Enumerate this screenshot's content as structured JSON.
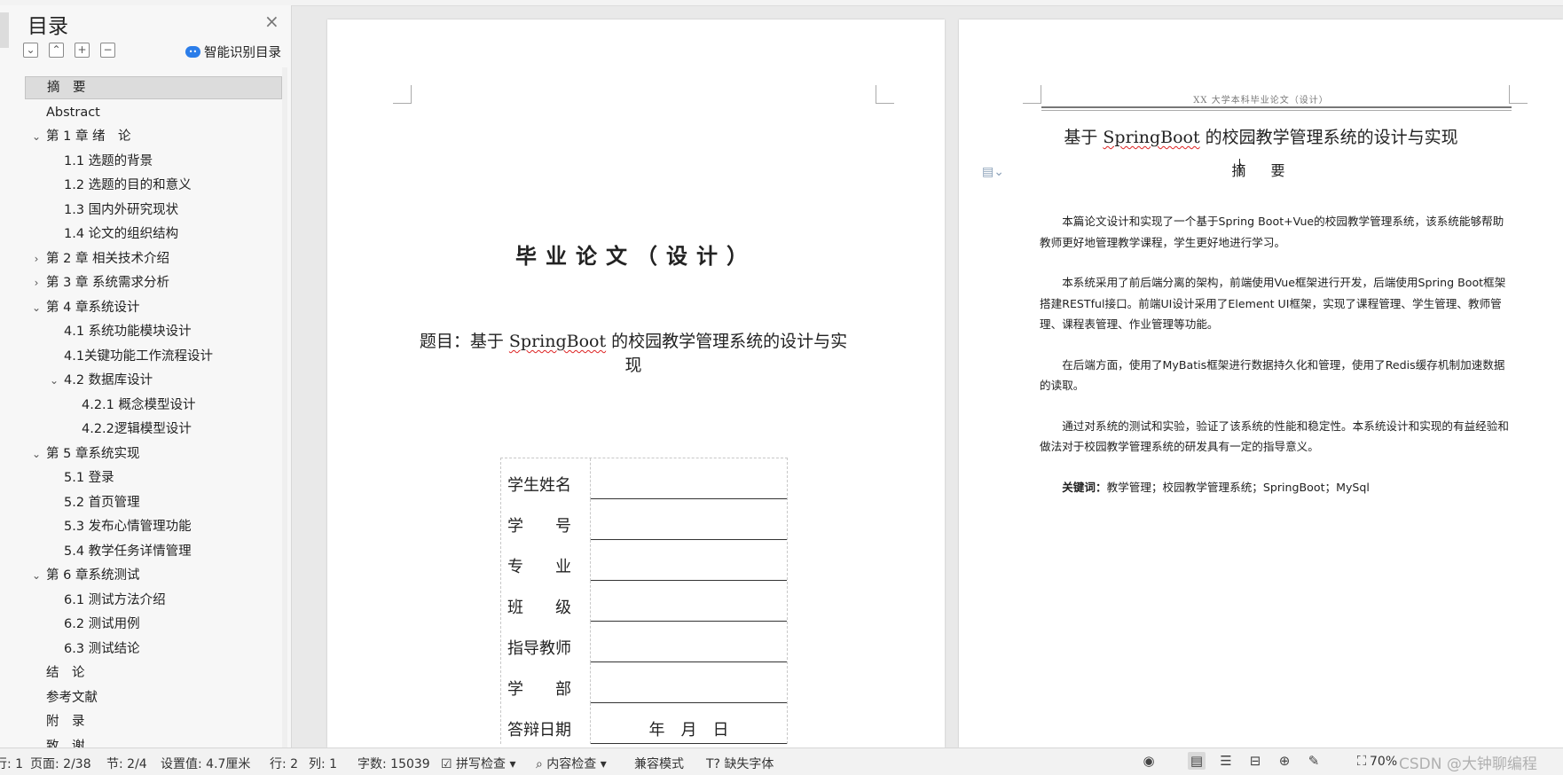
{
  "sidebar": {
    "title": "目录",
    "close_glyph": "×",
    "toolbar_glyphs": [
      "⌄",
      "⌃",
      "+",
      "−"
    ],
    "smart_toc_label": "智能识别目录",
    "items": [
      {
        "label": "摘　要",
        "level": 0,
        "chev": "",
        "selected": true
      },
      {
        "label": "Abstract",
        "level": 0,
        "chev": ""
      },
      {
        "label": "第 1 章  绪　论",
        "level": 0,
        "chev": "⌄"
      },
      {
        "label": "1.1  选题的背景",
        "level": 1,
        "chev": ""
      },
      {
        "label": "1.2  选题的目的和意义",
        "level": 1,
        "chev": ""
      },
      {
        "label": "1.3  国内外研究现状",
        "level": 1,
        "chev": ""
      },
      {
        "label": "1.4  论文的组织结构",
        "level": 1,
        "chev": ""
      },
      {
        "label": "第 2 章  相关技术介绍",
        "level": 0,
        "chev": "›"
      },
      {
        "label": "第 3 章  系统需求分析",
        "level": 0,
        "chev": "›"
      },
      {
        "label": "第 4 章系统设计",
        "level": 0,
        "chev": "⌄"
      },
      {
        "label": "4.1  系统功能模块设计",
        "level": 1,
        "chev": ""
      },
      {
        "label": "4.1关键功能工作流程设计",
        "level": 1,
        "chev": ""
      },
      {
        "label": "4.2  数据库设计",
        "level": 1,
        "chev": "⌄"
      },
      {
        "label": "4.2.1  概念模型设计",
        "level": 2,
        "chev": ""
      },
      {
        "label": "4.2.2逻辑模型设计",
        "level": 2,
        "chev": ""
      },
      {
        "label": "第 5 章系统实现",
        "level": 0,
        "chev": "⌄"
      },
      {
        "label": "5.1  登录",
        "level": 1,
        "chev": ""
      },
      {
        "label": "5.2  首页管理",
        "level": 1,
        "chev": ""
      },
      {
        "label": "5.3  发布心情管理功能",
        "level": 1,
        "chev": ""
      },
      {
        "label": "5.4  教学任务详情管理",
        "level": 1,
        "chev": ""
      },
      {
        "label": "第 6 章系统测试",
        "level": 0,
        "chev": "⌄"
      },
      {
        "label": "6.1  测试方法介绍",
        "level": 1,
        "chev": ""
      },
      {
        "label": "6.2  测试用例",
        "level": 1,
        "chev": ""
      },
      {
        "label": "6.3  测试结论",
        "level": 1,
        "chev": ""
      },
      {
        "label": "结　论",
        "level": 0,
        "chev": ""
      },
      {
        "label": "参考文献",
        "level": 0,
        "chev": ""
      },
      {
        "label": "附　录",
        "level": 0,
        "chev": ""
      },
      {
        "label": "致　谢",
        "level": 0,
        "chev": ""
      }
    ]
  },
  "page1": {
    "title": "毕业论文（设计）",
    "topic_prefix": "题目：基于 ",
    "topic_highlight": "SpringBoot",
    "topic_suffix": " 的校园教学管理系统的设计与实现",
    "fields": [
      {
        "label": "学生姓名",
        "value": ""
      },
      {
        "label": "学　　号",
        "value": ""
      },
      {
        "label": "专　　业",
        "value": ""
      },
      {
        "label": "班　　级",
        "value": ""
      },
      {
        "label": "指导教师",
        "value": ""
      },
      {
        "label": "学　　部",
        "value": ""
      },
      {
        "label": "答辩日期",
        "value": "年　月　日"
      }
    ]
  },
  "page2": {
    "header": "XX 大学本科毕业论文（设计）",
    "title_prefix": "基于 ",
    "title_highlight": "SpringBoot",
    "title_suffix": " 的校园教学管理系统的设计与实现",
    "abstract_heading": "摘　要",
    "paragraphs": [
      "本篇论文设计和实现了一个基于Spring Boot+Vue的校园教学管理系统，该系统能够帮助教师更好地管理教学课程，学生更好地进行学习。",
      "本系统采用了前后端分离的架构，前端使用Vue框架进行开发，后端使用Spring Boot框架搭建RESTful接口。前端UI设计采用了Element UI框架，实现了课程管理、学生管理、教师管理、课程表管理、作业管理等功能。",
      "在后端方面，使用了MyBatis框架进行数据持久化和管理，使用了Redis缓存机制加速数据的读取。",
      "通过对系统的测试和实验，验证了该系统的性能和稳定性。本系统设计和实现的有益经验和做法对于校园教学管理系统的研发具有一定的指导意义。"
    ],
    "keywords_label": "关键词：",
    "keywords_text": "教学管理；校园教学管理系统；SpringBoot；MySql"
  },
  "statusbar": {
    "row_partial": "行: 1",
    "page": "页面: 2/38",
    "section": "节: 2/4",
    "setting": "设置值: 4.7厘米",
    "line": "行: 2",
    "column": "列: 1",
    "word_count": "字数: 15039",
    "spell_check": "拼写检查",
    "content_check": "内容检查",
    "compat_mode": "兼容模式",
    "missing_fonts": "缺失字体",
    "zoom": "70%",
    "watermark": "CSDN @大钟聊编程"
  }
}
